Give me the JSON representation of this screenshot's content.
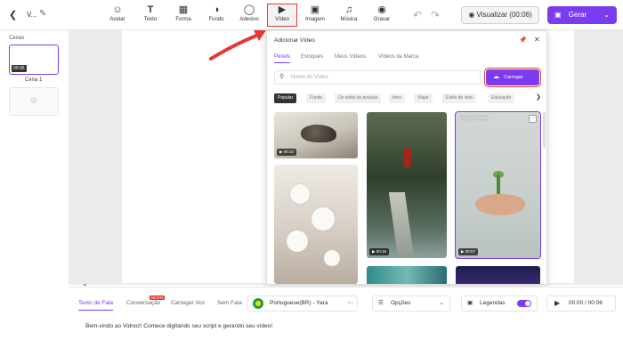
{
  "topbar": {
    "back_icon": "chevron-left-icon",
    "project_title": "V...",
    "edit_icon": "pencil-icon",
    "tools": [
      {
        "label": "Avatar",
        "icon": "avatar-icon"
      },
      {
        "label": "Texto",
        "icon": "text-icon"
      },
      {
        "label": "Forma",
        "icon": "shapes-icon"
      },
      {
        "label": "Fundo",
        "icon": "background-icon"
      },
      {
        "label": "Adesivo",
        "icon": "sticker-icon"
      },
      {
        "label": "Vídeo",
        "icon": "video-icon"
      },
      {
        "label": "Imagem",
        "icon": "image-icon"
      },
      {
        "label": "Música",
        "icon": "music-icon"
      },
      {
        "label": "Gravar",
        "icon": "record-icon"
      }
    ],
    "visualize_label": "Visualizar (00:06)",
    "generate_label": "Gerar"
  },
  "scenes": {
    "label": "Cenas",
    "items": [
      {
        "name": "Cena 1",
        "duration": "00:06"
      }
    ]
  },
  "video_panel": {
    "title": "Adicionar Vídeo",
    "tabs": [
      "Pexels",
      "Estoques",
      "Meus Vídeos",
      "Vídeos da Marca"
    ],
    "active_tab": "Pexels",
    "search_placeholder": "Nome do Vídeo",
    "upload_label": "Carregar",
    "chips": [
      "Popular",
      "Fundo",
      "De estilo às avulsas",
      "Intro",
      "Viajar",
      "Estilo de vida",
      "Educação"
    ],
    "thumbnails": [
      {
        "duration": "00:10"
      },
      {
        "duration": "00:16"
      },
      {
        "duration": "00:07",
        "caption": "Cup of Couple"
      }
    ]
  },
  "bottom": {
    "tabs": [
      "Texto de Fala",
      "Conversação",
      "Carregar Voz",
      "Sem Fala"
    ],
    "active_tab": "Texto de Fala",
    "new_badge": "NOVO",
    "voice": "Portuguese(BR) - Yara",
    "options_label": "Opções",
    "captions_label": "Legendas",
    "captions_on": true,
    "time": "00:00 / 00:06",
    "script_text": "Bem-vindo ao Vidnoz! Comece digitando seu script e gerando seu vídeo!"
  },
  "colors": {
    "accent": "#7b3cf0",
    "highlight": "#e53935"
  }
}
